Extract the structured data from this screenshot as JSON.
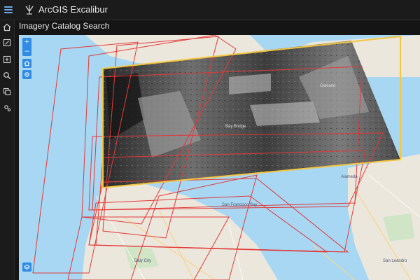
{
  "app": {
    "title": "ArcGIS Excalibur"
  },
  "panel": {
    "title": "Imagery Catalog Search"
  },
  "map": {
    "zoom_in": "+",
    "zoom_out": "–",
    "labels": [
      {
        "text": "Bay Bridge"
      },
      {
        "text": "Oakland"
      },
      {
        "text": "San Francisco Bay"
      },
      {
        "text": "Daly City"
      },
      {
        "text": "Alameda"
      },
      {
        "text": "San Leandro"
      }
    ]
  },
  "colors": {
    "accent": "#2f8be6",
    "footprint": "#e23a3a",
    "selected_footprint": "#f4c53d",
    "water": "#a7d7f2"
  },
  "icons": {
    "menu": "menu-icon",
    "logo": "excalibur-logo-icon",
    "sidebar": [
      "home-icon",
      "edit-icon",
      "add-icon",
      "search-icon",
      "layers-icon",
      "settings-icon"
    ],
    "map_tools": [
      "home-icon",
      "locate-icon",
      "basemap-icon"
    ]
  }
}
